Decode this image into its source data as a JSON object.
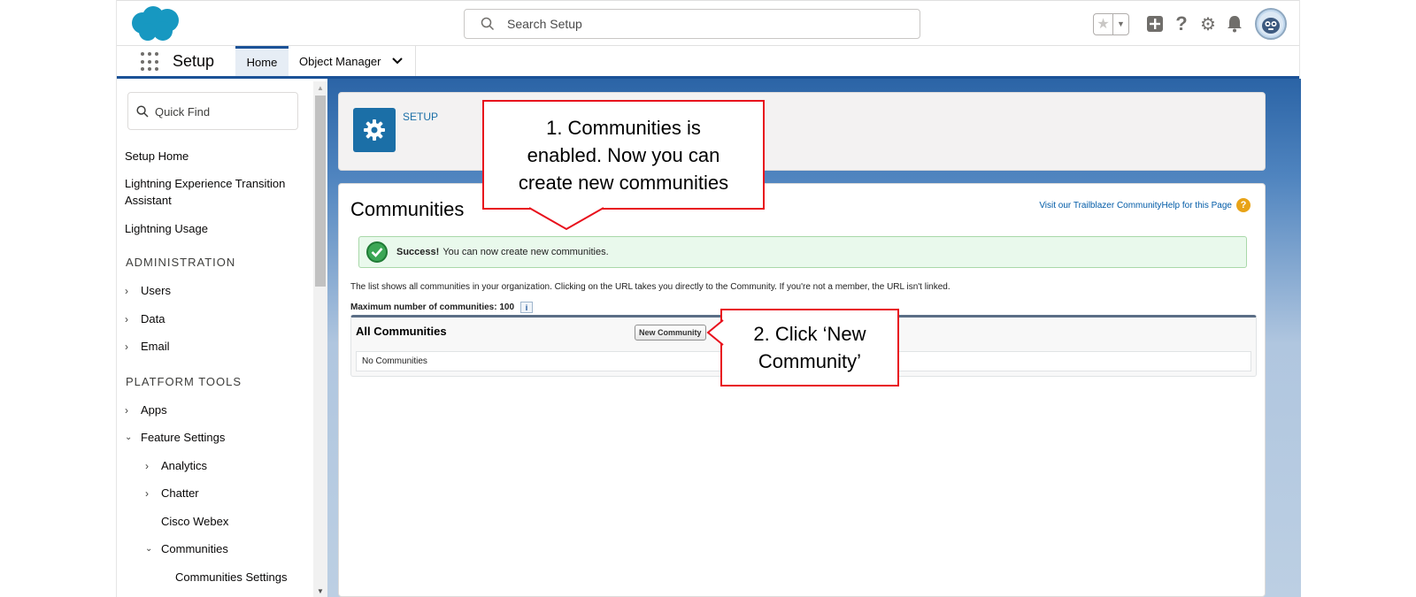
{
  "header": {
    "search_placeholder": "Search Setup",
    "icons": [
      "salesforce-cloud-logo",
      "search-icon",
      "favorites-star-icon",
      "dropdown-icon",
      "add-icon",
      "help-icon",
      "gear-icon",
      "bell-icon",
      "avatar"
    ]
  },
  "context_bar": {
    "app_name": "Setup",
    "tabs": [
      {
        "label": "Home",
        "active": true
      },
      {
        "label": "Object Manager",
        "active": false
      }
    ]
  },
  "sidebar": {
    "quick_find_placeholder": "Quick Find",
    "links": [
      "Setup Home",
      "Lightning Experience Transition Assistant",
      "Lightning Usage"
    ],
    "sections": [
      {
        "heading": "ADMINISTRATION",
        "items": [
          "Users",
          "Data",
          "Email"
        ]
      },
      {
        "heading": "PLATFORM TOOLS",
        "items": [
          "Apps",
          "Feature Settings",
          "Analytics",
          "Chatter",
          "Cisco Webex",
          "Communities",
          "Communities Settings"
        ]
      }
    ]
  },
  "page_header": {
    "label": "SETUP"
  },
  "content": {
    "title": "Communities",
    "help_links": "Visit our Trailblazer CommunityHelp for this Page",
    "success": {
      "strong": "Success!",
      "message": "You can now create new communities."
    },
    "description": "The list shows all communities in your organization. Clicking on the URL takes you directly to the Community. If you're not a member, the URL isn't linked.",
    "max_label": "Maximum number of communities: 100",
    "list": {
      "title": "All Communities",
      "button": "New Community",
      "empty": "No Communities"
    }
  },
  "callouts": {
    "one": {
      "line1": "1. Communities is",
      "line2": "enabled. Now you can",
      "line3": "create new communities"
    },
    "two": {
      "line1": "2. Click ‘New",
      "line2": "Community’"
    }
  },
  "colors": {
    "brand_blue": "#1b5297",
    "salesforce_cloud": "#1798c1",
    "callout_red": "#e8101c",
    "success_green": "#3ba755"
  }
}
